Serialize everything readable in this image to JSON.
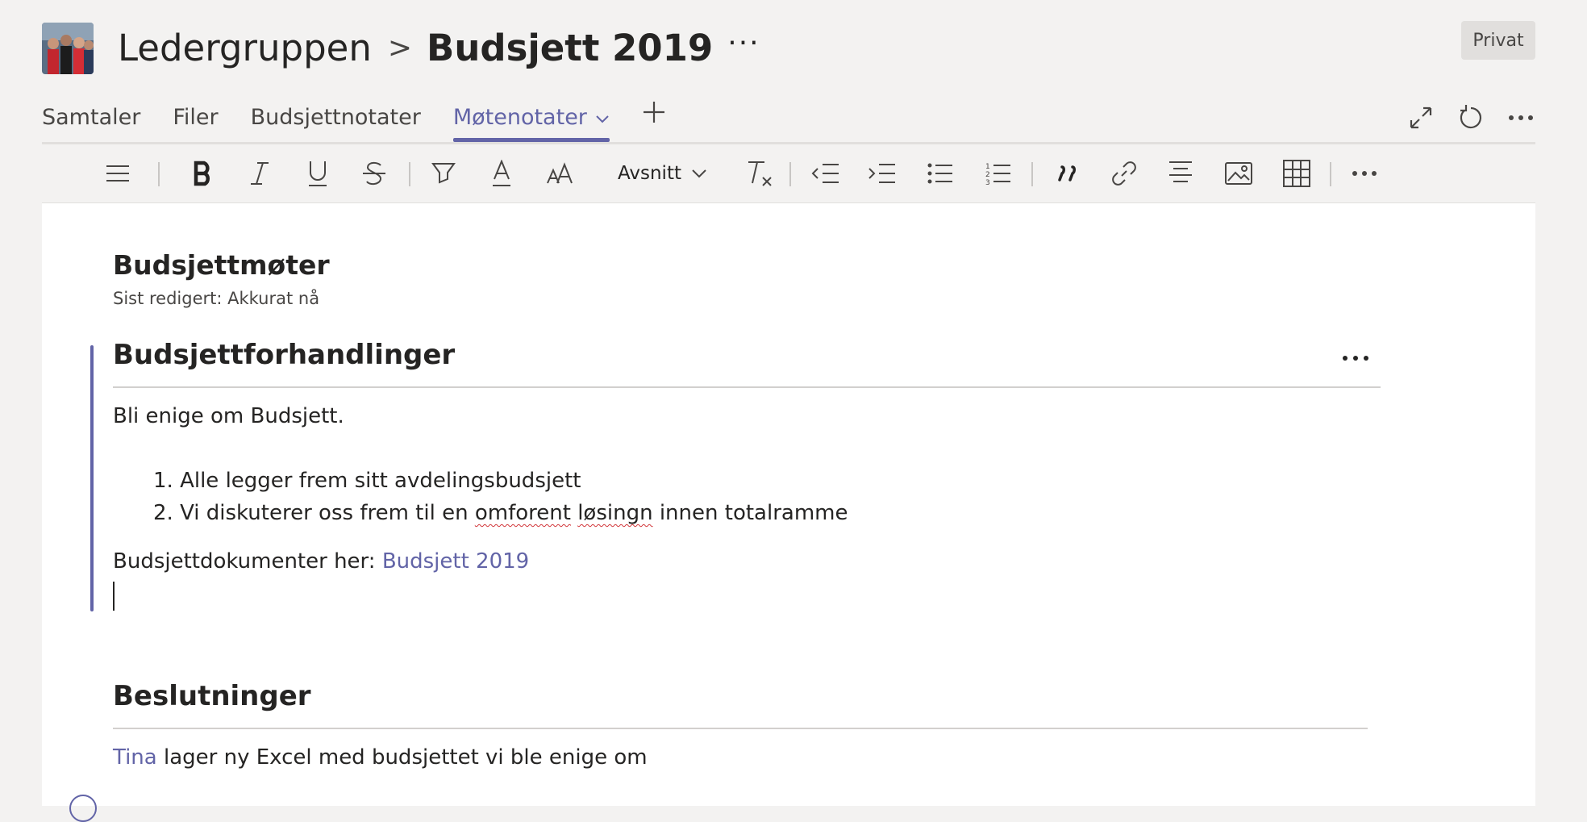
{
  "header": {
    "team_name": "Ledergruppen",
    "breadcrumb_separator": ">",
    "channel_name": "Budsjett 2019",
    "more_label": "···",
    "privacy_badge": "Privat"
  },
  "tabs": [
    {
      "label": "Samtaler",
      "active": false
    },
    {
      "label": "Filer",
      "active": false
    },
    {
      "label": "Budsjettnotater",
      "active": false
    },
    {
      "label": "Møtenotater",
      "active": true
    }
  ],
  "right_icons": [
    "expand-icon",
    "refresh-icon",
    "more-icon"
  ],
  "toolbar": {
    "paragraph_style": "Avsnitt",
    "icons": [
      "menu-icon",
      "bold-icon",
      "italic-icon",
      "underline-icon",
      "strikethrough-icon",
      "highlight-icon",
      "font-color-icon",
      "font-size-icon",
      "clear-formatting-icon",
      "decrease-indent-icon",
      "increase-indent-icon",
      "bullet-list-icon",
      "numbered-list-icon",
      "quote-icon",
      "link-icon",
      "align-icon",
      "image-icon",
      "table-icon",
      "more-icon"
    ]
  },
  "page": {
    "title": "Budsjettmøter",
    "last_edited": "Sist redigert: Akkurat nå"
  },
  "section1": {
    "heading": "Budsjettforhandlinger",
    "intro": "Bli enige om Budsjett.",
    "list": [
      {
        "num": "1.",
        "text": "Alle legger frem sitt avdelingsbudsjett"
      },
      {
        "num": "2.",
        "pre": "Vi diskuterer oss frem til en ",
        "err1": "omforent",
        "mid": " ",
        "err2": "løsingn",
        "post": " innen totalramme"
      }
    ],
    "docs_label": "Budsjettdokumenter her: ",
    "docs_link": "Budsjett 2019"
  },
  "section2": {
    "heading": "Beslutninger",
    "mention": "Tina",
    "text": " lager ny Excel med budsjettet vi ble enige om"
  },
  "colors": {
    "accent": "#6264a7",
    "background": "#f3f2f1",
    "spellcheck": "#d13438"
  }
}
